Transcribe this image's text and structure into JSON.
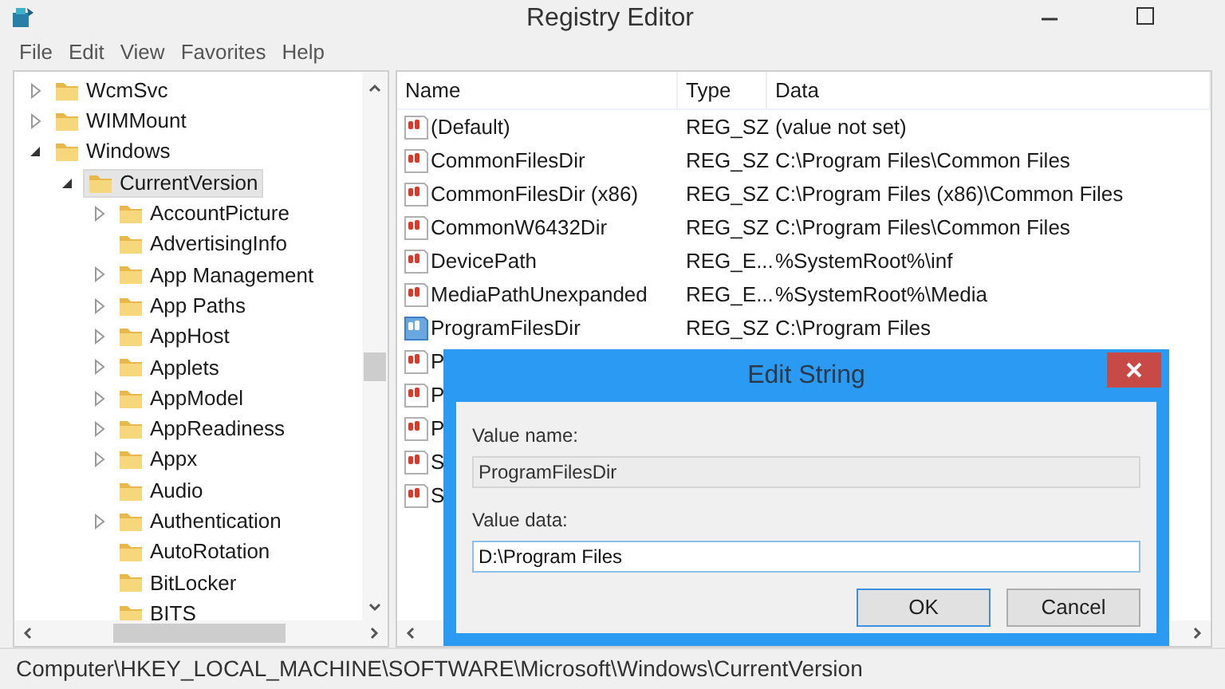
{
  "window": {
    "title": "Registry Editor"
  },
  "menu": [
    "File",
    "Edit",
    "View",
    "Favorites",
    "Help"
  ],
  "tree": [
    {
      "label": "WcmSvc",
      "kind": "branch",
      "expanded": false,
      "selected": false
    },
    {
      "label": "WIMMount",
      "kind": "branch",
      "expanded": false,
      "selected": false
    },
    {
      "label": "Windows",
      "kind": "branch",
      "expanded": true,
      "selected": false,
      "children": [
        {
          "label": "CurrentVersion",
          "kind": "branch",
          "expanded": true,
          "selected": true,
          "children": [
            {
              "label": "AccountPicture",
              "kind": "branch",
              "expanded": false,
              "selected": false
            },
            {
              "label": "AdvertisingInfo",
              "kind": "leaf",
              "selected": false
            },
            {
              "label": "App Management",
              "kind": "branch",
              "expanded": false,
              "selected": false
            },
            {
              "label": "App Paths",
              "kind": "branch",
              "expanded": false,
              "selected": false
            },
            {
              "label": "AppHost",
              "kind": "branch",
              "expanded": false,
              "selected": false
            },
            {
              "label": "Applets",
              "kind": "branch",
              "expanded": false,
              "selected": false
            },
            {
              "label": "AppModel",
              "kind": "branch",
              "expanded": false,
              "selected": false
            },
            {
              "label": "AppReadiness",
              "kind": "branch",
              "expanded": false,
              "selected": false
            },
            {
              "label": "Appx",
              "kind": "branch",
              "expanded": false,
              "selected": false
            },
            {
              "label": "Audio",
              "kind": "leaf",
              "selected": false
            },
            {
              "label": "Authentication",
              "kind": "branch",
              "expanded": false,
              "selected": false
            },
            {
              "label": "AutoRotation",
              "kind": "leaf",
              "selected": false
            },
            {
              "label": "BitLocker",
              "kind": "leaf",
              "selected": false
            },
            {
              "label": "BITS",
              "kind": "leaf",
              "selected": false
            }
          ]
        }
      ]
    }
  ],
  "table": {
    "columns": [
      "Name",
      "Type",
      "Data"
    ],
    "rows": [
      {
        "name": "(Default)",
        "type": "REG_SZ",
        "data": "(value not set)",
        "selected": false
      },
      {
        "name": "CommonFilesDir",
        "type": "REG_SZ",
        "data": "C:\\Program Files\\Common Files",
        "selected": false
      },
      {
        "name": "CommonFilesDir (x86)",
        "type": "REG_SZ",
        "data": "C:\\Program Files (x86)\\Common Files",
        "selected": false
      },
      {
        "name": "CommonW6432Dir",
        "type": "REG_SZ",
        "data": "C:\\Program Files\\Common Files",
        "selected": false
      },
      {
        "name": "DevicePath",
        "type": "REG_E...",
        "data": "%SystemRoot%\\inf",
        "selected": false
      },
      {
        "name": "MediaPathUnexpanded",
        "type": "REG_E...",
        "data": "%SystemRoot%\\Media",
        "selected": false
      },
      {
        "name": "ProgramFilesDir",
        "type": "REG_SZ",
        "data": "C:\\Program Files",
        "selected": true
      },
      {
        "name": "P",
        "selected": false
      },
      {
        "name": "P",
        "selected": false
      },
      {
        "name": "P",
        "selected": false
      },
      {
        "name": "S",
        "selected": false
      },
      {
        "name": "S",
        "selected": false
      }
    ]
  },
  "status_bar": "Computer\\HKEY_LOCAL_MACHINE\\SOFTWARE\\Microsoft\\Windows\\CurrentVersion",
  "dialog": {
    "title": "Edit String",
    "name_label": "Value name:",
    "name_value": "ProgramFilesDir",
    "data_label": "Value data:",
    "data_value": "D:\\Program Files",
    "buttons": [
      {
        "label": "OK",
        "focused": true
      },
      {
        "label": "Cancel",
        "focused": false
      }
    ]
  }
}
